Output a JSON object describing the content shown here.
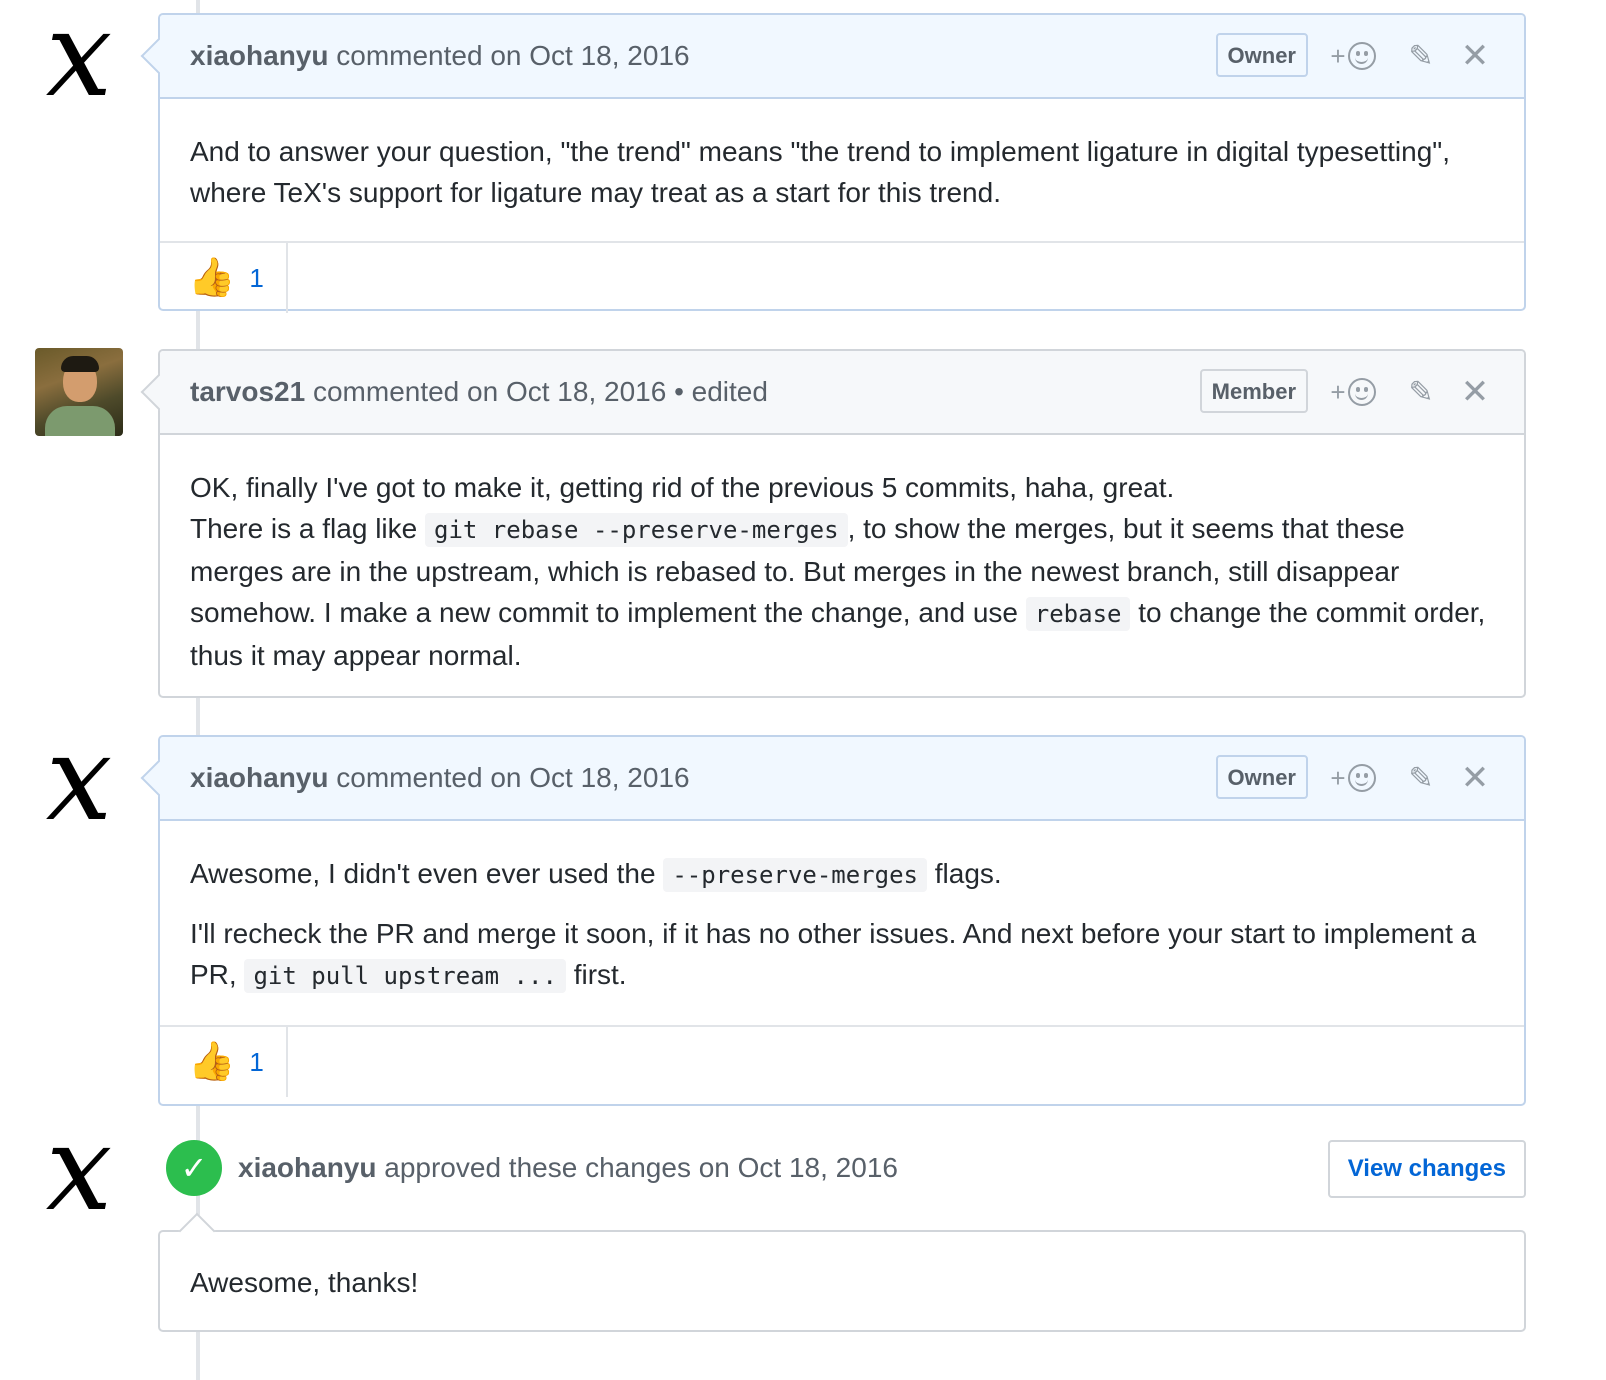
{
  "comments": [
    {
      "author": "xiaohanyu",
      "meta": "commented on Oct 18, 2016",
      "badge": "Owner",
      "avatar_glyph": "x",
      "body_text": "And to answer your question, \"the trend\" means \"the trend to implement ligature in digital typesetting\", where TeX's support for ligature may treat as a start for this trend.",
      "reaction": {
        "icon": "thumbs-up",
        "emoji": "👍",
        "count": "1"
      }
    },
    {
      "author": "tarvos21",
      "meta": "commented on Oct 18, 2016 • edited",
      "badge": "Member",
      "avatar_glyph": "",
      "body_line1": "OK, finally I've got to make it, getting rid of the previous 5 commits, haha, great.",
      "body_part1": "There is a flag like",
      "code1": "git rebase --preserve-merges",
      "body_part2": ", to show the merges, but it seems that these merges are in the upstream, which is rebased to. But merges in the newest branch, still disappear somehow. I make a new commit to implement the change, and use",
      "code2": "rebase",
      "body_part3": "to change the commit order, thus it may appear normal."
    },
    {
      "author": "xiaohanyu",
      "meta": "commented on Oct 18, 2016",
      "badge": "Owner",
      "avatar_glyph": "x",
      "p1_part1": "Awesome, I didn't even ever used the",
      "p1_code": "--preserve-merges",
      "p1_part2": "flags.",
      "p2_part1": "I'll recheck the PR and merge it soon, if it has no other issues. And next before your start to implement a PR,",
      "p2_code": "git pull upstream ...",
      "p2_part2": "first.",
      "reaction": {
        "icon": "thumbs-up",
        "emoji": "👍",
        "count": "1"
      }
    }
  ],
  "review": {
    "author": "xiaohanyu",
    "meta": "approved these changes on Oct 18, 2016",
    "button": "View changes",
    "status_color": "#2cbe4e",
    "avatar_glyph": "x",
    "body": "Awesome, thanks!"
  },
  "icons": {
    "add_reaction": "+",
    "edit": "✎",
    "close": "✕",
    "check": "✓"
  },
  "colors": {
    "owner_header_bg": "#f1f8ff",
    "owner_border": "#c0d3eb",
    "link_blue": "#0366d6"
  }
}
